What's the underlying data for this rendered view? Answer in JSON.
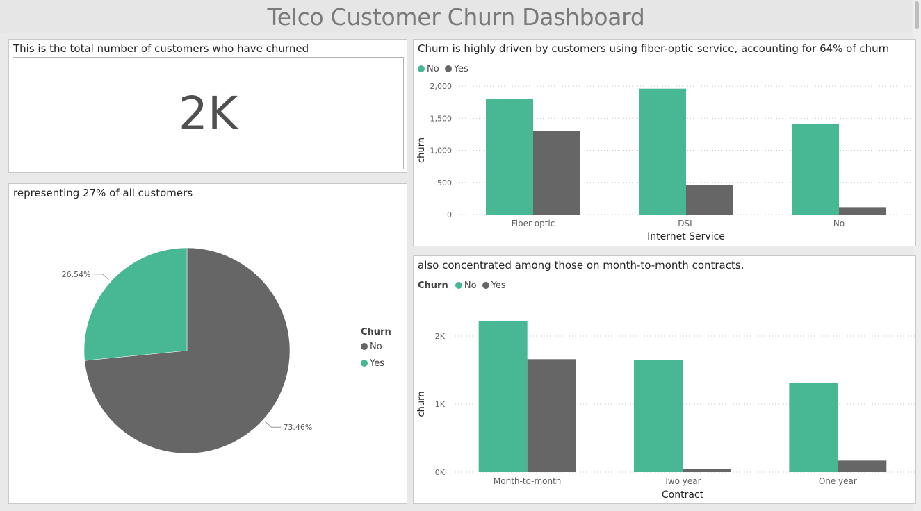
{
  "dashboard": {
    "title": "Telco Customer Churn Dashboard"
  },
  "colors": {
    "no": "#47b794",
    "yes": "#666666"
  },
  "kpi": {
    "title": "This is the total number of customers who have churned",
    "value": "2K"
  },
  "pie_card": {
    "title": "representing 27% of all customers",
    "legend_title": "Churn",
    "legend_items": [
      "No",
      "Yes"
    ]
  },
  "bar1_card": {
    "title": "Churn is highly driven by customers using fiber-optic service, accounting for 64% of churn",
    "legend_items": [
      "No",
      "Yes"
    ]
  },
  "bar2_card": {
    "title": "also concentrated among those on month-to-month contracts.",
    "legend_title": "Churn",
    "legend_items": [
      "No",
      "Yes"
    ]
  },
  "chart_data": [
    {
      "type": "pie",
      "title": "representing 27% of all customers",
      "legend_title": "Churn",
      "categories": [
        "No",
        "Yes"
      ],
      "values": [
        73.46,
        26.54
      ],
      "labels": [
        "73.46%",
        "26.54%"
      ],
      "legend_placement": "right"
    },
    {
      "type": "bar",
      "title": "Churn is highly driven by customers using fiber-optic service, accounting for 64% of churn",
      "xlabel": "Internet Service",
      "ylabel": "churn",
      "categories": [
        "Fiber optic",
        "DSL",
        "No"
      ],
      "series": [
        {
          "name": "No",
          "values": [
            1800,
            1960,
            1410
          ]
        },
        {
          "name": "Yes",
          "values": [
            1300,
            460,
            115
          ]
        }
      ],
      "ylim": [
        0,
        2000
      ],
      "yticks": [
        0,
        500,
        1000,
        1500,
        2000
      ],
      "ytick_labels": [
        "0",
        "500",
        "1,000",
        "1,500",
        "2,000"
      ],
      "grid": true,
      "legend_placement": "top-left"
    },
    {
      "type": "bar",
      "title": "also concentrated among those on month-to-month contracts.",
      "xlabel": "Contract",
      "ylabel": "churn",
      "legend_title": "Churn",
      "categories": [
        "Month-to-month",
        "Two year",
        "One year"
      ],
      "series": [
        {
          "name": "No",
          "values": [
            2220,
            1650,
            1310
          ]
        },
        {
          "name": "Yes",
          "values": [
            1660,
            50,
            170
          ]
        }
      ],
      "ylim": [
        0,
        2000
      ],
      "yticks": [
        0,
        1000,
        2000
      ],
      "ytick_labels": [
        "0K",
        "1K",
        "2K"
      ],
      "grid": true,
      "legend_placement": "top-left"
    }
  ]
}
